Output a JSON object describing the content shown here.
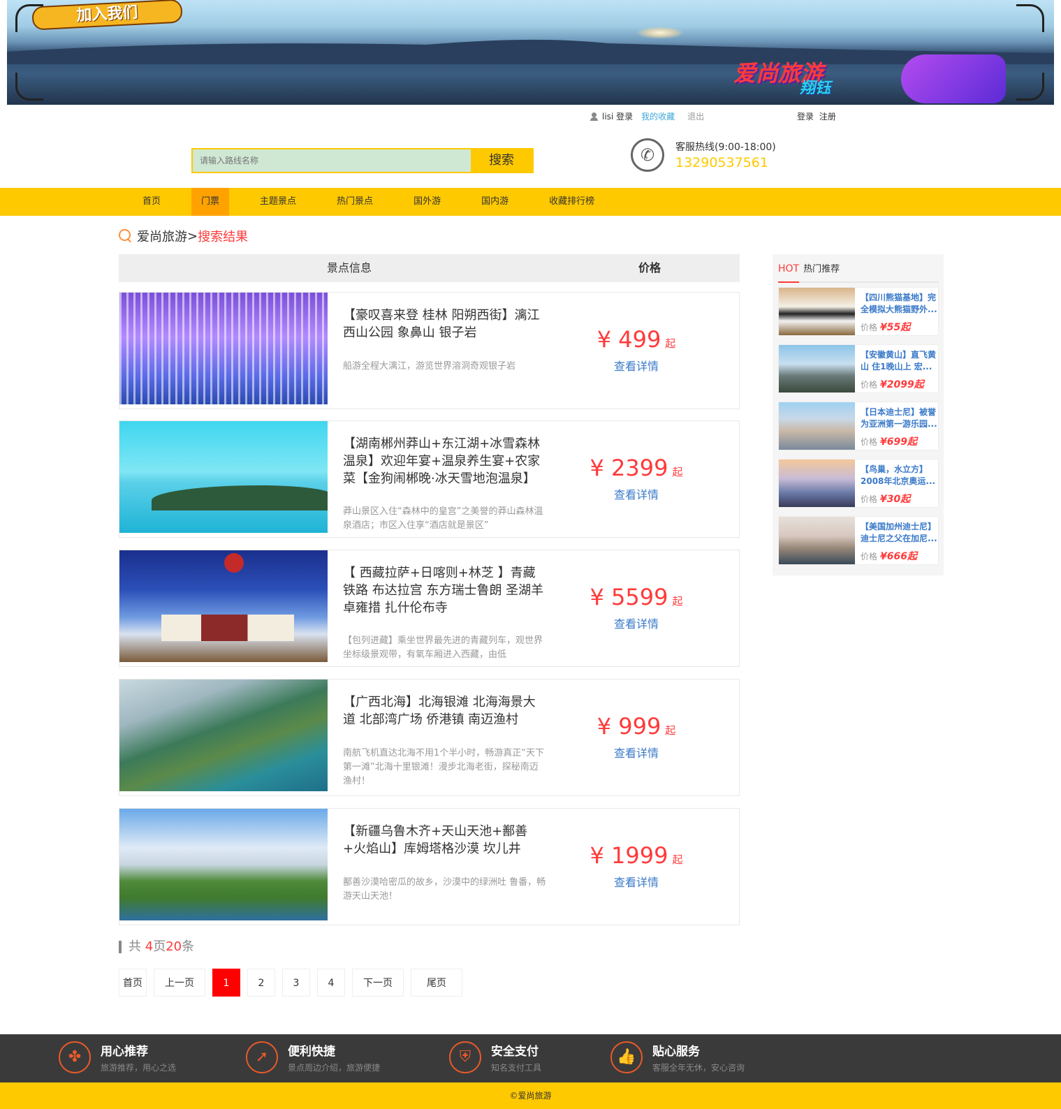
{
  "banner": {
    "badge": "加入我们",
    "brand": "爱尚旅游",
    "brand_sub": "翔钰"
  },
  "userbar": {
    "user": "lisi",
    "login_label": "登录",
    "favorites": "我的收藏",
    "logout": "退出",
    "login": "登录",
    "register": "注册"
  },
  "search": {
    "placeholder": "请输入路线名称",
    "button": "搜索"
  },
  "hotline": {
    "label": "客服热线(9:00-18:00)",
    "number": "13290537561"
  },
  "nav": {
    "items": [
      "首页",
      "门票",
      "主题景点",
      "热门景点",
      "国外游",
      "国内游",
      "收藏排行榜"
    ],
    "active_index": 1
  },
  "breadcrumb": {
    "root": "爱尚旅游",
    "sep": ">",
    "current": "搜索结果"
  },
  "table": {
    "col_info": "景点信息",
    "col_price": "价格",
    "currency": "¥",
    "qi": "起",
    "detail_label": "查看详情",
    "rows": [
      {
        "title": "【豪叹喜来登 桂林 阳朔西街】漓江 西山公园 象鼻山 银子岩",
        "desc": "船游全程大漓江，游览世界溶洞奇观银子岩",
        "price": "499"
      },
      {
        "title": "【湖南郴州莽山+东江湖+冰雪森林温泉】欢迎年宴+温泉养生宴+农家菜【金狗闹郴晚·冰天雪地泡温泉】",
        "desc": "莽山景区入住“森林中的皇宫”之美誉的莽山森林温泉酒店；市区入住享“酒店就是景区”",
        "price": "2399"
      },
      {
        "title": "【 西藏拉萨+日喀则+林芝 】青藏铁路 布达拉宫 东方瑞士鲁朗 圣湖羊卓雍措 扎什伦布寺",
        "desc": "【包列进藏】乘坐世界最先进的青藏列车，观世界坐标级景观带，有氧车厢进入西藏，由低",
        "price": "5599"
      },
      {
        "title": "【广西北海】北海银滩 北海海景大道 北部湾广场 侨港镇 南迈渔村",
        "desc": "南航飞机直达北海不用1个半小时，畅游真正“天下第一滩”北海十里银滩！漫步北海老街，探秘南迈渔村！",
        "price": "999"
      },
      {
        "title": "【新疆乌鲁木齐+天山天池+鄯善+火焰山】库姆塔格沙漠 坎儿井",
        "desc": "鄯善沙漠哈密瓜的故乡，沙漠中的绿洲吐 鲁番，畅游天山天池！",
        "price": "1999"
      }
    ]
  },
  "total": {
    "prefix": "共 ",
    "pages": "4",
    "pages_unit": "页",
    "count": "20",
    "count_unit": "条"
  },
  "pager": {
    "first": "首页",
    "prev": "上一页",
    "pages": [
      "1",
      "2",
      "3",
      "4"
    ],
    "current": "1",
    "next": "下一页",
    "last": "尾页"
  },
  "hot": {
    "tag": "HOT",
    "title": "热门推荐",
    "price_label": "价格",
    "currency": "¥",
    "qi": "起",
    "items": [
      {
        "title": "【四川熊猫基地】完全模拟大熊猫野外...",
        "price": "55"
      },
      {
        "title": "【安徽黄山】直飞黄山 住1晚山上 宏...",
        "price": "2099"
      },
      {
        "title": "【日本迪士尼】被誉为亚洲第一游乐园...",
        "price": "699"
      },
      {
        "title": "【鸟巢，水立方】2008年北京奥运...",
        "price": "30"
      },
      {
        "title": "【美国加州迪士尼】迪士尼之父在加尼...",
        "price": "666"
      }
    ]
  },
  "footer": {
    "items": [
      {
        "title": "用心推荐",
        "sub": "旅游推荐，用心之选"
      },
      {
        "title": "便利快捷",
        "sub": "景点周边介绍，旅游便捷"
      },
      {
        "title": "安全支付",
        "sub": "知名支付工具"
      },
      {
        "title": "贴心服务",
        "sub": "客服全年无休，安心咨询"
      }
    ],
    "copyright": "©爱尚旅游"
  }
}
